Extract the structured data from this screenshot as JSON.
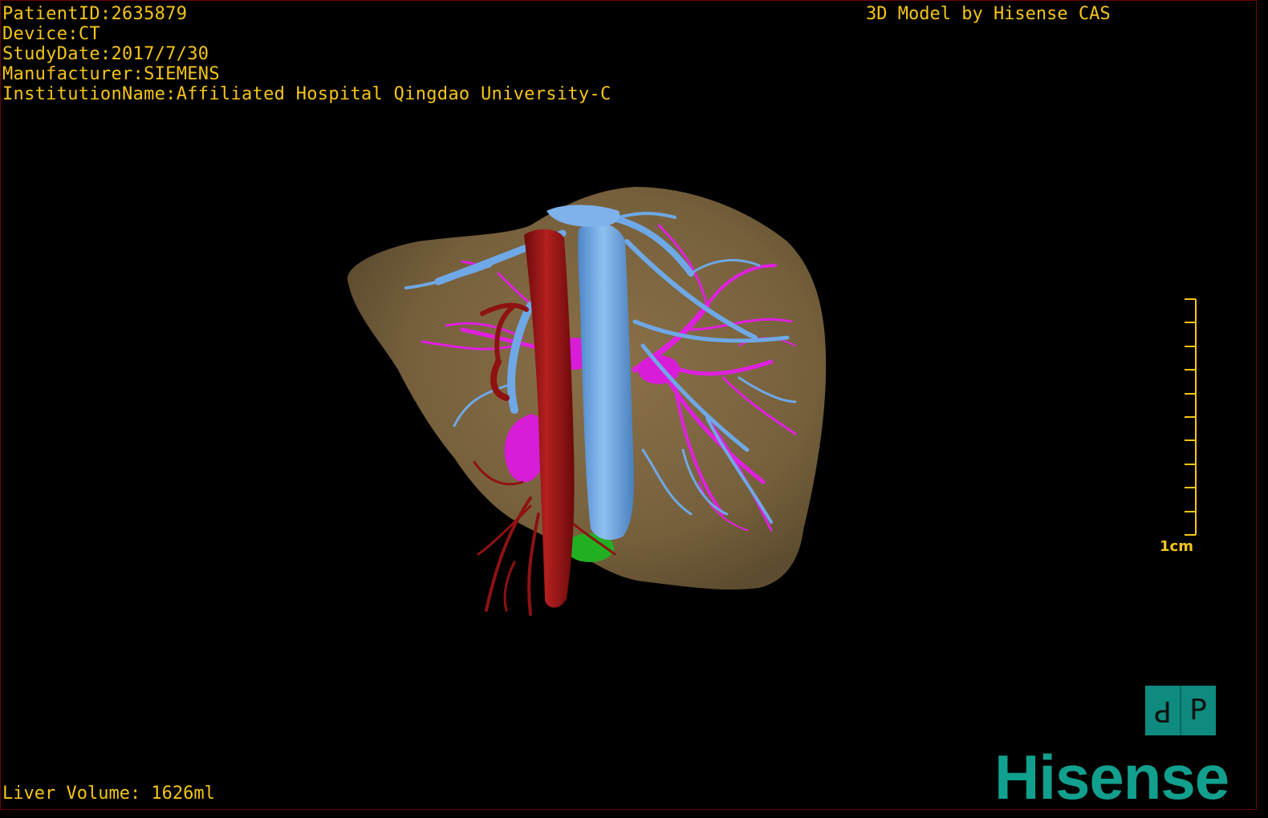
{
  "patient_info": {
    "patient_id": "PatientID:2635879",
    "device": "Device:CT",
    "study_date": "StudyDate:2017/7/30",
    "manufacturer": "Manufacturer:SIEMENS",
    "institution": "InstitutionName:Affiliated Hospital Qingdao University-C"
  },
  "credit": "3D Model by Hisense CAS",
  "volume": "Liver Volume: 1626ml",
  "scale_bar": {
    "label": "1cm",
    "ticks": 10
  },
  "orientation": {
    "left": "P",
    "right": "P"
  },
  "logo": "Hisense",
  "colors": {
    "text": "#f5c518",
    "liver": "#7a6340",
    "hepatic_vein": "#6fa8e6",
    "portal_vein": "#e020e0",
    "artery": "#9a1414",
    "gallbladder": "#22b022",
    "brand": "#12a08e"
  }
}
